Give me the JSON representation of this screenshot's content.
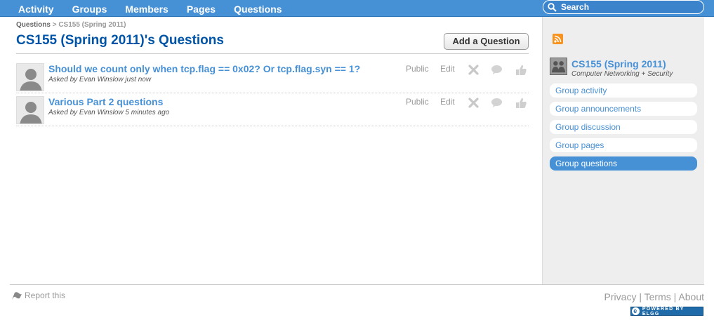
{
  "topnav": {
    "items": [
      "Activity",
      "Groups",
      "Members",
      "Pages",
      "Questions"
    ]
  },
  "search": {
    "placeholder": "Search"
  },
  "breadcrumb": {
    "root": "Questions",
    "separator": ">",
    "current": "CS155 (Spring 2011)"
  },
  "page": {
    "title": "CS155 (Spring 2011)'s Questions",
    "add_button": "Add a Question"
  },
  "questions": [
    {
      "title": "Should we count only when tcp.flag == 0x02? Or tcp.flag.syn == 1?",
      "meta": "Asked by Evan Winslow just now",
      "access": "Public",
      "edit": "Edit"
    },
    {
      "title": "Various Part 2 questions",
      "meta": "Asked by Evan Winslow 5 minutes ago",
      "access": "Public",
      "edit": "Edit"
    }
  ],
  "sidebar": {
    "group_name": "CS155 (Spring 2011)",
    "group_description": "Computer Networking + Security",
    "menu": [
      "Group activity",
      "Group announcements",
      "Group discussion",
      "Group pages",
      "Group questions"
    ],
    "active_item": "Group questions"
  },
  "footer": {
    "report": "Report this",
    "links": [
      "Privacy",
      "Terms",
      "About"
    ],
    "separator": "|",
    "powered": "POWERED BY ELGG"
  },
  "colors": {
    "accent": "#4690d6",
    "title": "#0054a7",
    "sidebar_bg": "#eeeeee"
  }
}
